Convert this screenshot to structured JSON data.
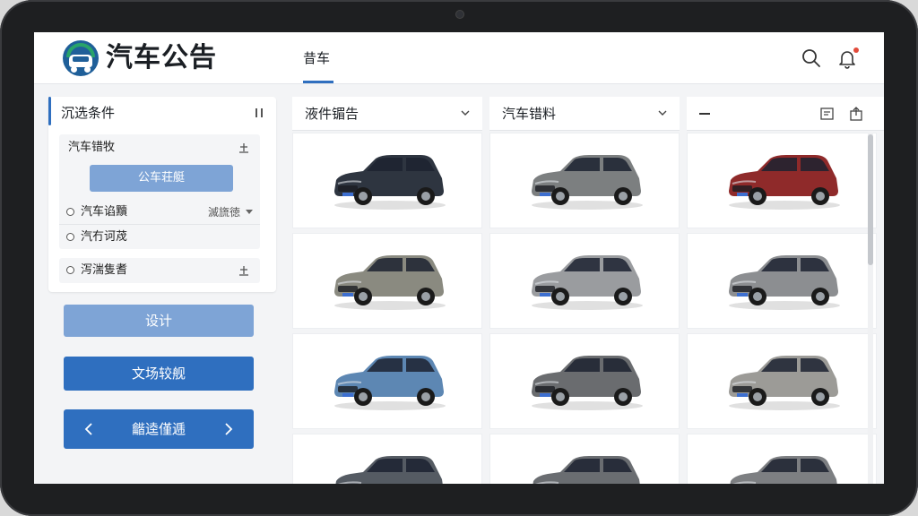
{
  "app": {
    "title": "汽车公告",
    "nav_tab": "昔车"
  },
  "header_icons": [
    "search-icon",
    "bell-icon"
  ],
  "sidebar": {
    "filter_title": "沉选条件",
    "group": {
      "title": "汽车错牧",
      "pill_label": "公车荘艇",
      "rows": [
        {
          "label": "汽车谄黷",
          "value": "滅旒徳"
        },
        {
          "label": "汽冇诃荗",
          "value": ""
        }
      ]
    },
    "lone_row": {
      "label": "泻湍隻耆"
    },
    "buttons": {
      "design": "设计",
      "compare": "文场较舰",
      "pager": "龤逵僅逓"
    }
  },
  "columns": [
    {
      "title": "液件镅告"
    },
    {
      "title": "汽车错料"
    },
    {
      "title": "—"
    }
  ],
  "colors": {
    "primary": "#2f6fbf",
    "primary_light": "#7ea4d6",
    "accent_green": "#29a36a",
    "notification": "#e24b3b"
  },
  "cars": [
    [
      "#2e3540",
      "#7c7f80",
      "#8f2a2a"
    ],
    [
      "#8a8a80",
      "#9a9c9f",
      "#8c8e91"
    ],
    [
      "#5d87b3",
      "#6a6c6f",
      "#9c9b97"
    ],
    [
      "#555b63",
      "#6a6d71",
      "#7d7f82"
    ]
  ]
}
